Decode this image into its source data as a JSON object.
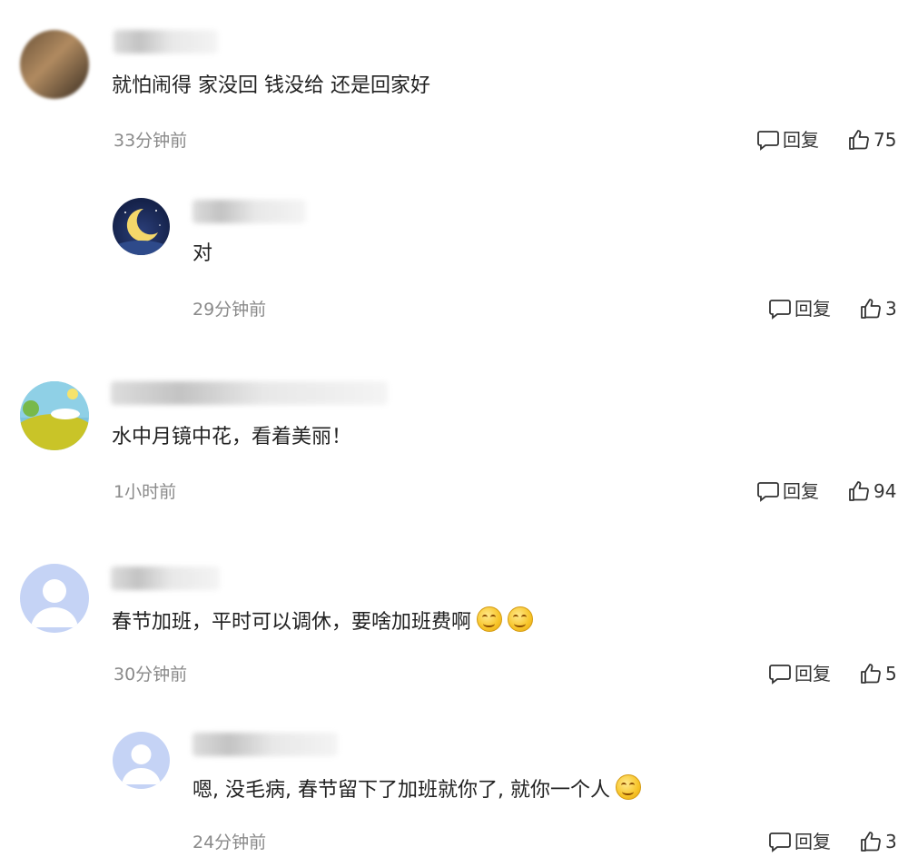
{
  "comments": [
    {
      "text": "就怕闹得 家没回 钱没给 还是回家好",
      "time": "33分钟前",
      "reply_label": "回复",
      "likes": "75"
    },
    {
      "text": "对",
      "time": "29分钟前",
      "reply_label": "回复",
      "likes": "3"
    },
    {
      "text": "水中月镜中花，看着美丽！",
      "time": "1小时前",
      "reply_label": "回复",
      "likes": "94"
    },
    {
      "text": "春节加班，平时可以调休，要啥加班费啊",
      "time": "30分钟前",
      "reply_label": "回复",
      "likes": "5"
    },
    {
      "text": "嗯, 没毛病, 春节留下了加班就你了, 就你一个人",
      "time": "24分钟前",
      "reply_label": "回复",
      "likes": "3"
    }
  ],
  "icons": {
    "reply": "comment-bubble-icon",
    "like": "thumbs-up-icon",
    "emoji": "smiley-emoji-icon"
  },
  "colors": {
    "time": "#8a8a8a",
    "text": "#222222",
    "default_avatar": "#c5d3f5"
  }
}
